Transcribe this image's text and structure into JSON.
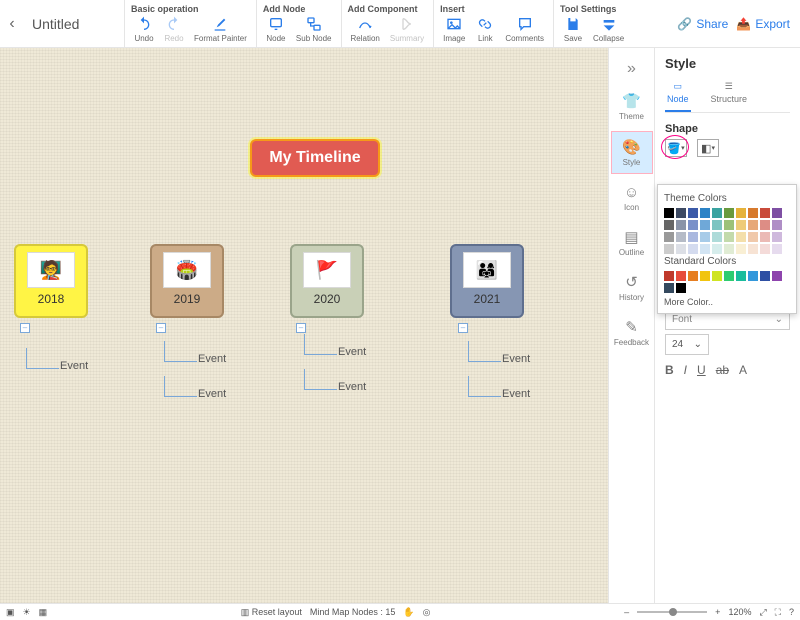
{
  "doc": {
    "title": "Untitled"
  },
  "toolbar": {
    "groups": {
      "basic": {
        "title": "Basic operation",
        "undo": "Undo",
        "redo": "Redo",
        "fmt": "Format Painter"
      },
      "addnode": {
        "title": "Add Node",
        "node": "Node",
        "sub": "Sub Node"
      },
      "addcomp": {
        "title": "Add Component",
        "relation": "Relation",
        "summary": "Summary"
      },
      "insert": {
        "title": "Insert",
        "image": "Image",
        "link": "Link",
        "comments": "Comments"
      },
      "tool": {
        "title": "Tool Settings",
        "save": "Save",
        "collapse": "Collapse"
      }
    },
    "share": "Share",
    "export": "Export"
  },
  "mindmap": {
    "root": "My Timeline",
    "years": [
      "2018",
      "2019",
      "2020",
      "2021"
    ],
    "event_label": "Event"
  },
  "siderail": {
    "theme": "Theme",
    "style": "Style",
    "icon": "Icon",
    "outline": "Outline",
    "history": "History",
    "feedback": "Feedback"
  },
  "panel": {
    "title": "Style",
    "tab_node": "Node",
    "tab_structure": "Structure",
    "shape": "Shape",
    "theme_colors": "Theme Colors",
    "standard_colors": "Standard Colors",
    "more_color": "More Color..",
    "font_section": "Font",
    "font_placeholder": "Font",
    "font_size": "24",
    "fmt": {
      "b": "B",
      "i": "I",
      "u": "U",
      "ab": "ab",
      "a": "A"
    },
    "theme_swatches": [
      "#000000",
      "#3d4a63",
      "#3b5aa8",
      "#2c83c6",
      "#3aa3a0",
      "#6a9a3e",
      "#e6b23a",
      "#d77a2d",
      "#c94b3b",
      "#7e4fa3",
      "#666666",
      "#8a94a8",
      "#7a90c9",
      "#6fa8d8",
      "#7cc4c1",
      "#9cc178",
      "#eecb78",
      "#e7a878",
      "#dd8d85",
      "#af8ec6",
      "#999999",
      "#b5bbc7",
      "#aab8df",
      "#a7cbe8",
      "#aedbd9",
      "#c3daab",
      "#f4dfaa",
      "#f0c9ab",
      "#ebbab5",
      "#cfb9dd",
      "#cccccc",
      "#dcdfe6",
      "#d4dbef",
      "#d2e4f3",
      "#d6edec",
      "#e0ecd4",
      "#f9efd4",
      "#f7e3d4",
      "#f4dbd9",
      "#e6dbee"
    ],
    "std_swatches": [
      "#c0392b",
      "#e74c3c",
      "#e67e22",
      "#f1c40f",
      "#cfe423",
      "#2ecc71",
      "#1abc9c",
      "#3498db",
      "#2e4fa3",
      "#8e44ad",
      "#34495e",
      "#000000"
    ]
  },
  "status": {
    "reset": "Reset layout",
    "count_label": "Mind Map Nodes :",
    "count": "15",
    "zoom": "120%"
  }
}
